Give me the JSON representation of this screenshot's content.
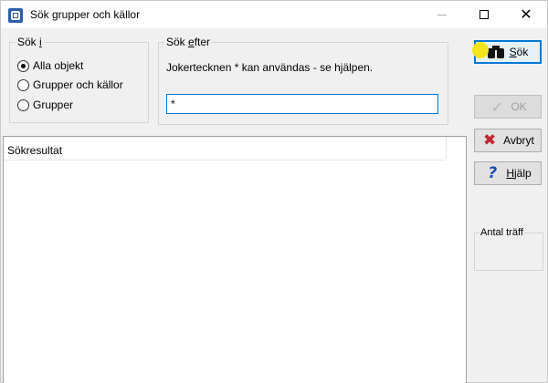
{
  "window": {
    "title": "Sök grupper och källor",
    "controls": {
      "minimize": "—",
      "maximize": "",
      "close": "✕"
    }
  },
  "search_in": {
    "legend_prefix": "Sök ",
    "legend_mnemonic": "i",
    "options": [
      {
        "label": "Alla objekt",
        "checked": true
      },
      {
        "label": "Grupper och källor",
        "checked": false
      },
      {
        "label": "Grupper",
        "checked": false
      }
    ]
  },
  "search_for": {
    "legend_prefix": "Sök ",
    "legend_mnemonic": "e",
    "legend_suffix": "fter",
    "hint": "Jokertecknen * kan användas - se hjälpen.",
    "value": "*"
  },
  "results": {
    "header": "Sökresultat"
  },
  "buttons": {
    "search": {
      "mnemonic": "S",
      "rest": "ök",
      "icon": "binoculars-icon"
    },
    "ok": {
      "label": "OK",
      "icon": "check-icon"
    },
    "cancel": {
      "label": "Avbryt",
      "icon": "x-icon"
    },
    "help": {
      "mnemonic": "H",
      "rest": "jälp",
      "icon": "question-icon"
    }
  },
  "hits": {
    "label": "Antal träff"
  },
  "colors": {
    "accent": "#0078d7",
    "cancel_icon": "#c0272d",
    "help_icon": "#1a4db3",
    "cursor_highlight": "#f3e51d"
  }
}
